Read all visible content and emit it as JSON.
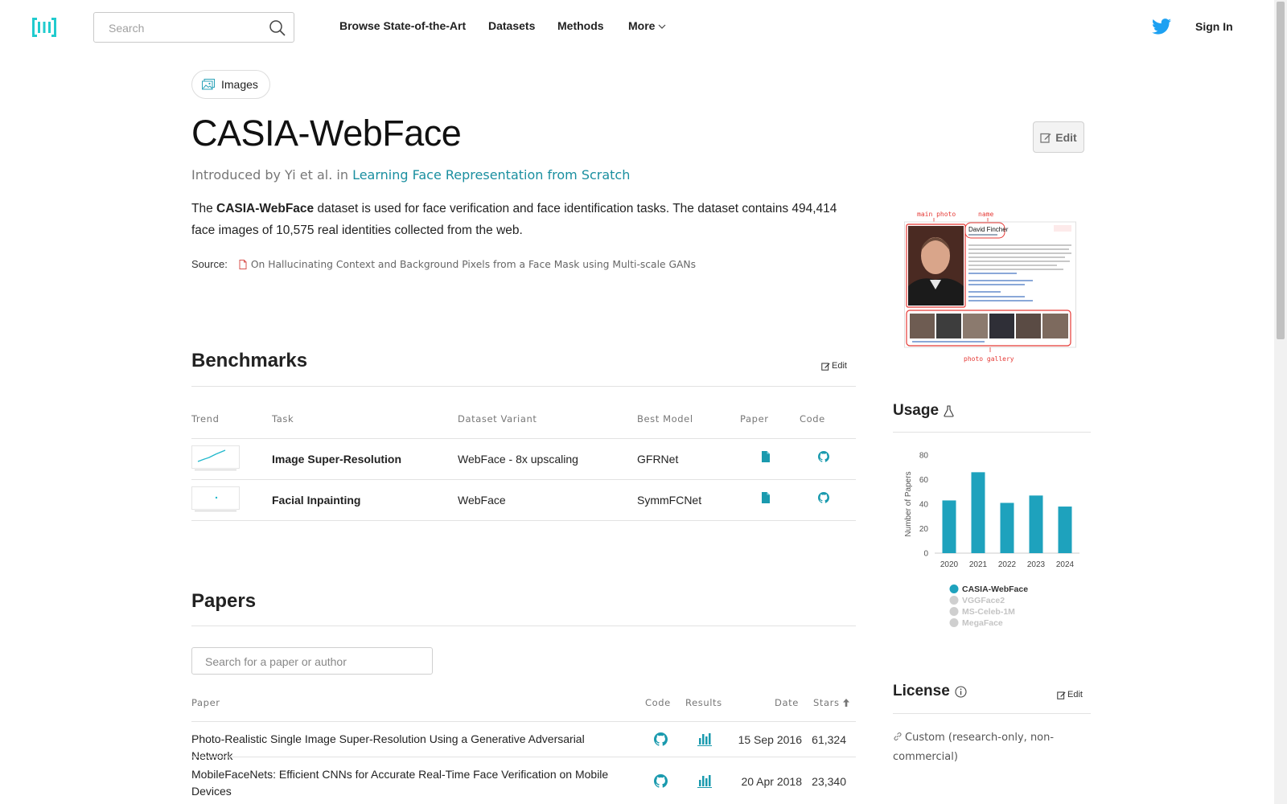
{
  "header": {
    "search_placeholder": "Search",
    "nav": [
      "Browse State-of-the-Art",
      "Datasets",
      "Methods",
      "More"
    ],
    "signin": "Sign In"
  },
  "modality": "Images",
  "dataset": {
    "title": "CASIA-WebFace",
    "edit_label": "Edit",
    "intro_prefix": "Introduced by Yi et al. in ",
    "intro_link": "Learning Face Representation from Scratch",
    "desc_prefix": "The ",
    "desc_bold": "CASIA-WebFace",
    "desc_rest": " dataset is used for face verification and face identification tasks. The dataset contains 494,414 face images of 10,575 real identities collected from the web.",
    "source_label": "Source:",
    "source_link": "On Hallucinating Context and Background Pixels from a Face Mask using Multi-scale GANs"
  },
  "image_labels": {
    "main_photo": "main photo",
    "name": "name",
    "person": "David Fincher",
    "gallery": "photo gallery"
  },
  "benchmarks": {
    "heading": "Benchmarks",
    "edit": "Edit",
    "columns": [
      "Trend",
      "Task",
      "Dataset Variant",
      "Best Model",
      "Paper",
      "Code"
    ],
    "rows": [
      {
        "task": "Image Super-Resolution",
        "variant": "WebFace - 8x upscaling",
        "model": "GFRNet"
      },
      {
        "task": "Facial Inpainting",
        "variant": "WebFace",
        "model": "SymmFCNet"
      }
    ]
  },
  "usage": {
    "heading": "Usage",
    "accent": "#1ea2bd",
    "chart_data": {
      "type": "bar",
      "categories": [
        "2020",
        "2021",
        "2022",
        "2023",
        "2024"
      ],
      "values": [
        43,
        66,
        41,
        47,
        38
      ],
      "ylabel": "Number of Papers",
      "ylim": [
        0,
        80
      ],
      "yticks": [
        "0",
        "20",
        "40",
        "60",
        "80"
      ],
      "legend": [
        "CASIA-WebFace",
        "VGGFace2",
        "MS-Celeb-1M",
        "MegaFace"
      ]
    }
  },
  "license": {
    "heading": "License",
    "edit": "Edit",
    "value": "Custom (research-only, non-commercial)"
  },
  "papers": {
    "heading": "Papers",
    "search_placeholder": "Search for a paper or author",
    "columns": [
      "Paper",
      "Code",
      "Results",
      "Date",
      "Stars"
    ],
    "rows": [
      {
        "title": "Photo-Realistic Single Image Super-Resolution Using a Generative Adversarial Network",
        "date": "15 Sep 2016",
        "stars": "61,324"
      },
      {
        "title": "MobileFaceNets: Efficient CNNs for Accurate Real-Time Face Verification on Mobile Devices",
        "date": "20 Apr 2018",
        "stars": "23,340"
      }
    ]
  }
}
